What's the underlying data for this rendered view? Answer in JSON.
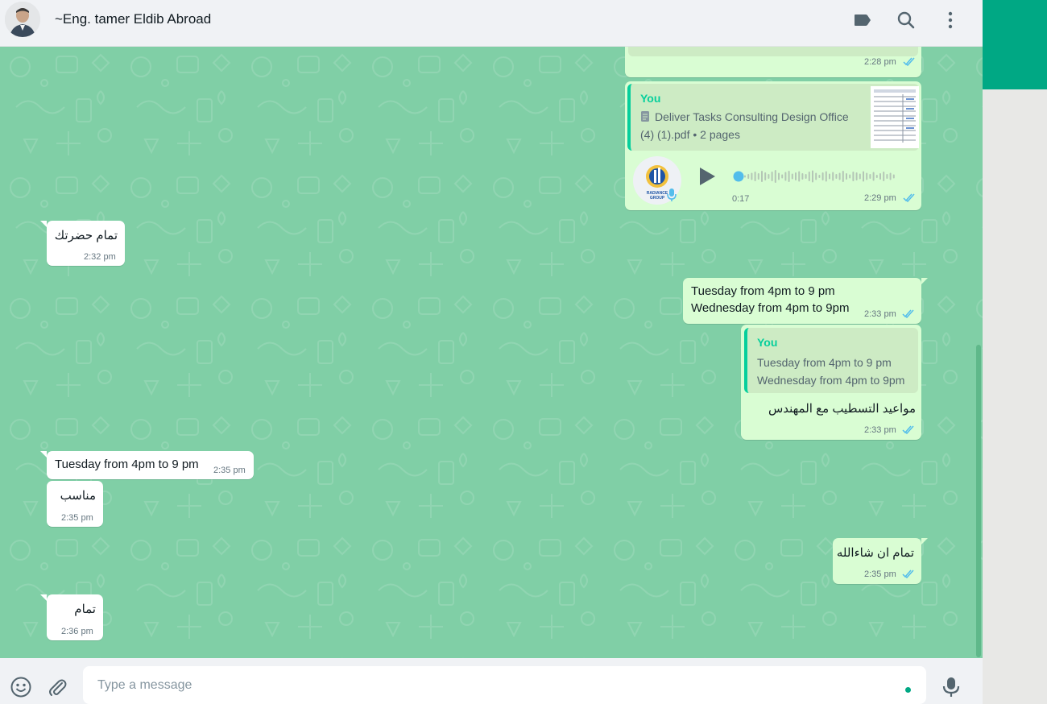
{
  "header": {
    "contact_name": "~Eng. tamer Eldib Abroad"
  },
  "messages": {
    "m0": {
      "time": "2:28 pm"
    },
    "m1": {
      "quote_sender": "You",
      "quote_line1": "Deliver Tasks Consulting Design Office",
      "quote_line2": "(4) (1).pdf • 2 pages",
      "duration": "0:17",
      "time": "2:29 pm",
      "avatar_label": "RADIANCE GROUP"
    },
    "m2": {
      "text": "تمام حضرتك",
      "time": "2:32 pm"
    },
    "m3": {
      "line1": "Tuesday from 4pm to 9 pm",
      "line2": "Wednesday from 4pm to 9pm",
      "time": "2:33 pm"
    },
    "m4": {
      "quote_sender": "You",
      "quote_line1": "Tuesday from 4pm to 9 pm",
      "quote_line2": "Wednesday from 4pm to 9pm",
      "text": "مواعيد التسطيب مع المهندس",
      "time": "2:33 pm"
    },
    "m5": {
      "text": "Tuesday from 4pm to 9 pm",
      "time": "2:35 pm"
    },
    "m6": {
      "text": "مناسب",
      "time": "2:35 pm"
    },
    "m7": {
      "text": "تمام ان شاءالله",
      "time": "2:35 pm"
    },
    "m8": {
      "text": "تمام",
      "time": "2:36 pm"
    }
  },
  "footer": {
    "placeholder": "Type a message"
  },
  "colors": {
    "accent": "#00a884",
    "wallpaper": "#80cfa6",
    "outgoing": "#d9fdd3",
    "incoming": "#ffffff",
    "read_ticks": "#53bdeb"
  },
  "icons": [
    "label-icon",
    "search-icon",
    "menu-icon",
    "emoji-icon",
    "attach-icon",
    "mic-icon",
    "play-icon",
    "document-icon"
  ]
}
